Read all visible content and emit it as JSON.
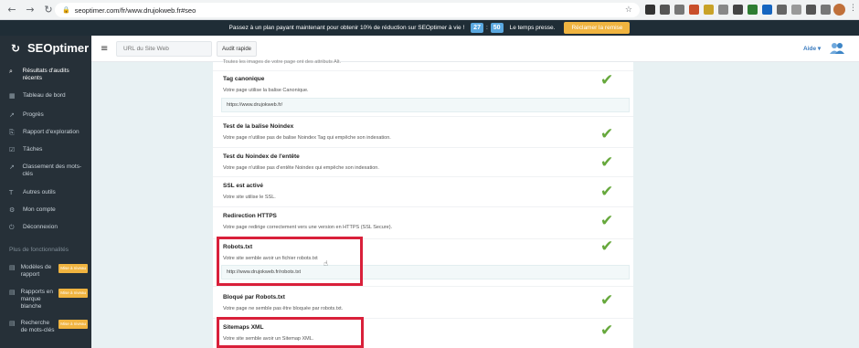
{
  "browser": {
    "url": "seoptimer.com/fr/www.drujokweb.fr#seo",
    "back_glyph": "←",
    "forward_glyph": "→",
    "reload_glyph": "↻",
    "home_glyph": "⌂",
    "lock_glyph": "🔒",
    "star_glyph": "☆",
    "menu_glyph": "⋮"
  },
  "promo": {
    "text": "Passez à un plan payant maintenant pour obtenir 10% de réduction sur SEOptimer à vie !",
    "timer_min": "27",
    "timer_sep": ":",
    "timer_sec": "50",
    "hurry": "Le temps presse.",
    "claim": "Réclamer la remise"
  },
  "sidebar": {
    "logo": "SEOptimer",
    "logo_glyph": "↻",
    "items": [
      {
        "label": "Résultats d'audits récents",
        "icon": "search-icon",
        "glyph": "⌕"
      },
      {
        "label": "Tableau de bord",
        "icon": "grid-icon",
        "glyph": "▦"
      },
      {
        "label": "Progrès",
        "icon": "chart-icon",
        "glyph": "↗"
      },
      {
        "label": "Rapport d'exploration",
        "icon": "crawl-icon",
        "glyph": "⎘"
      },
      {
        "label": "Tâches",
        "icon": "tasks-icon",
        "glyph": "☑"
      },
      {
        "label": "Classement des mots-clés",
        "icon": "ranking-icon",
        "glyph": "↗"
      },
      {
        "label": "Autres outils",
        "icon": "tools-icon",
        "glyph": "T"
      },
      {
        "label": "Mon compte",
        "icon": "account-icon",
        "glyph": "⚙"
      },
      {
        "label": "Déconnexion",
        "icon": "logout-icon",
        "glyph": "⏻"
      }
    ],
    "section": "Plus de fonctionnalités",
    "pro_items": [
      {
        "label": "Modèles de rapport",
        "icon": "template-icon",
        "glyph": "▤",
        "badge": "Mise à niveau"
      },
      {
        "label": "Rapports en marque blanche",
        "icon": "whitelabel-icon",
        "glyph": "▤",
        "badge": "Mise à niveau"
      },
      {
        "label": "Recherche de mots-clés",
        "icon": "keyword-icon",
        "glyph": "▤",
        "badge": "Mise à niveau"
      }
    ]
  },
  "topbar": {
    "menu_glyph": "≡",
    "url_placeholder": "URL du Site Web",
    "audit_button": "Audit rapide",
    "help": "Aide ▾"
  },
  "checks": {
    "check_glyph": "✔",
    "top_partial": "Toutes les images de votre page ont des attributs Alt.",
    "canonical": {
      "title": "Tag canonique",
      "desc": "Votre page utilise la balise Canonique.",
      "url": "https://www.drujokweb.fr/"
    },
    "noindex_tag": {
      "title": "Test de la balise Noindex",
      "desc": "Votre page n'utilise pas de balise Noindex Tag qui empêche son indexation."
    },
    "noindex_header": {
      "title": "Test du Noindex de l'entête",
      "desc": "Votre page n'utilise pas d'entête Noindex qui empêche son indexation."
    },
    "ssl": {
      "title": "SSL est activé",
      "desc": "Votre site utilise le SSL."
    },
    "https_redirect": {
      "title": "Redirection HTTPS",
      "desc": "Votre page redirige correctement vers une version en HTTPS (SSL Secure)."
    },
    "robots": {
      "title": "Robots.txt",
      "desc": "Votre site semble avoir un fichier robots.txt",
      "url": "http://www.drujokweb.fr/robots.txt"
    },
    "blocked": {
      "title": "Bloqué par Robots.txt",
      "desc": "Votre page ne semble pas être bloquée par robots.txt."
    },
    "sitemap": {
      "title": "Sitemaps XML",
      "desc": "Votre site semble avoir un Sitemap XML."
    }
  },
  "colors": {
    "accent": "#66a83c",
    "highlight": "#d9203a",
    "sidebar": "#263038"
  }
}
